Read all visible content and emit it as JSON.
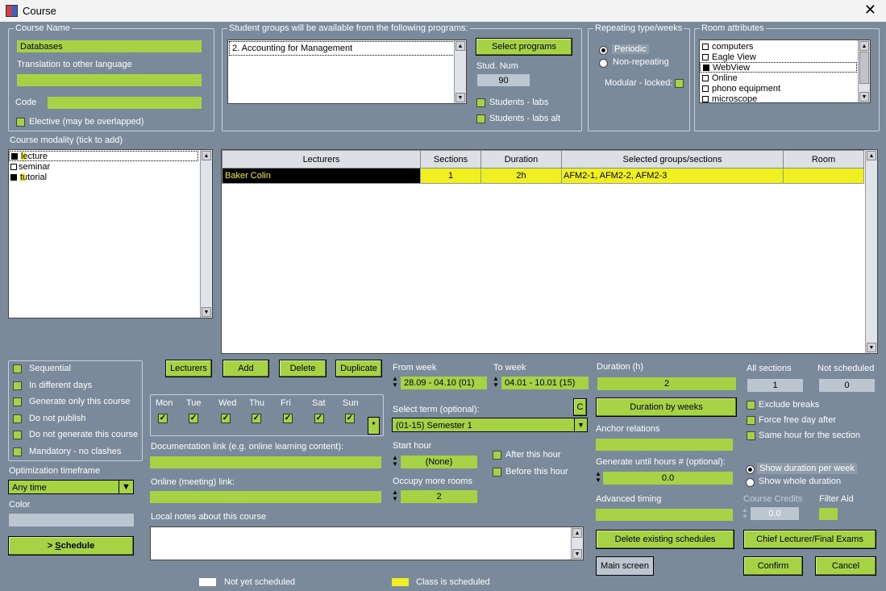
{
  "window": {
    "title": "Course",
    "close": "✕"
  },
  "course": {
    "legend": "Course Name",
    "name": "Databases",
    "translation_label": "Translation to other language",
    "translation": "",
    "code_label": "Code",
    "code": "",
    "elective_label": "Elective (may be overlapped)"
  },
  "programs": {
    "legend": "Student groups will be available from the following programs:",
    "items": [
      "2. Accounting for Management"
    ],
    "select_button": "Select programs",
    "stud_num_label": "Stud. Num",
    "stud_num": "90",
    "labs_label": "Students - labs",
    "labs_alt_label": "Students - labs alt"
  },
  "repeating": {
    "legend": "Repeating type/weeks",
    "periodic": "Periodic",
    "non_repeating": "Non-repeating",
    "modular": "Modular - locked:"
  },
  "attributes": {
    "legend": "Room attributes",
    "items": [
      {
        "label": "computers",
        "checked": false
      },
      {
        "label": "Eagle View",
        "checked": false
      },
      {
        "label": "WebView",
        "checked": true
      },
      {
        "label": "Online",
        "checked": false
      },
      {
        "label": "phono equipment",
        "checked": false
      },
      {
        "label": "microscope",
        "checked": false
      }
    ]
  },
  "modality": {
    "label": "Course modality (tick to add)",
    "items": [
      {
        "label": "lecture",
        "checked": true
      },
      {
        "label": "seminar",
        "checked": false
      },
      {
        "label": "tutorial",
        "checked": true
      }
    ]
  },
  "table": {
    "headers": [
      "Lecturers",
      "Sections",
      "Duration",
      "Selected groups/sections",
      "Room"
    ],
    "rows": [
      [
        "Baker Colin",
        "1",
        "2h",
        "AFM2-1, AFM2-2, AFM2-3",
        ""
      ]
    ]
  },
  "options": [
    "Sequential",
    "In different days",
    "Generate only this course",
    "Do not publish",
    "Do not generate this course",
    "Mandatory - no clashes"
  ],
  "actions": {
    "lecturers": "Lecturers",
    "add": "Add",
    "delete": "Delete",
    "duplicate": "Duplicate"
  },
  "days": [
    "Mon",
    "Tue",
    "Wed",
    "Thu",
    "Fri",
    "Sat",
    "Sun"
  ],
  "day_extra": "*",
  "weeks": {
    "from_label": "From week",
    "from": "28.09 - 04.10 (01)",
    "to_label": "To week",
    "to": "04.01 - 10.01 (15)",
    "term_label": "Select term (optional):",
    "c_button": "C",
    "term": "(01-15) Semester 1"
  },
  "links": {
    "doc_label": "Documentation link (e.g. online learning content):",
    "online_label": "Online (meeting) link:",
    "notes_label": "Local notes about this course"
  },
  "timing": {
    "start_label": "Start hour",
    "start": "(None)",
    "after": "After this hour",
    "before": "Before this hour",
    "occupy_label": "Occupy more rooms",
    "occupy": "2",
    "duration_label": "Duration (h)",
    "duration": "2",
    "duration_by_weeks": "Duration by weeks",
    "anchor_label": "Anchor relations",
    "generate_label": "Generate until hours # (optional):",
    "generate": "0.0",
    "advanced_label": "Advanced timing"
  },
  "sections": {
    "all_label": "All sections",
    "all": "1",
    "not_sched_label": "Not scheduled",
    "not_sched": "0",
    "exclude_breaks": "Exclude breaks",
    "force_free": "Force free day after",
    "same_hour": "Same hour for the section",
    "show_per_week": "Show duration per week",
    "show_whole": "Show whole duration",
    "credits_label": "Course Credits",
    "credits": "0.0",
    "filter_label": "Filter Aid"
  },
  "optimization": {
    "label": "Optimization timeframe",
    "value": "Any time",
    "color_label": "Color"
  },
  "buttons": {
    "schedule_prefix": "> ",
    "schedule_underlined": "S",
    "schedule_rest": "chedule",
    "delete_existing": "Delete existing schedules",
    "chief": "Chief Lecturer/Final Exams",
    "main_screen": "Main screen",
    "confirm": "Confirm",
    "cancel": "Cancel"
  },
  "legend_bar": {
    "not_scheduled": "Not yet scheduled",
    "scheduled": "Class is scheduled"
  },
  "colors": {
    "accent": "#a6d245",
    "background": "#7a8a9a",
    "highlight": "#f0f020"
  }
}
